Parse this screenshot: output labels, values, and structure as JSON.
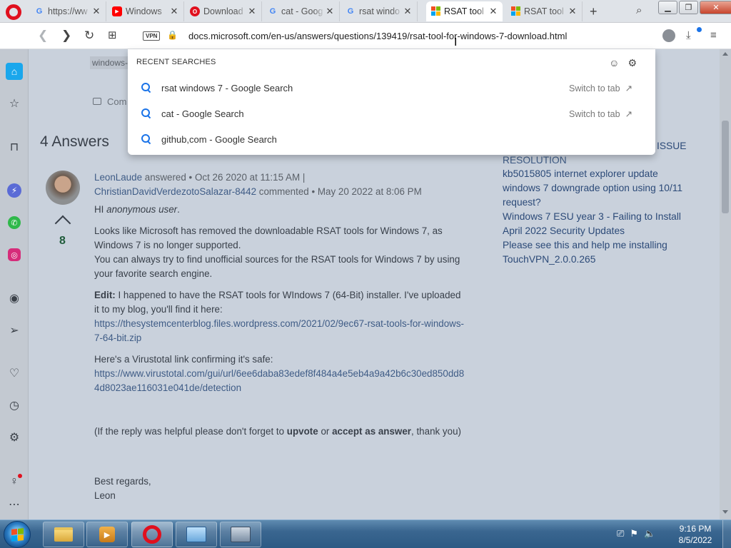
{
  "tabs": [
    {
      "favicon": "google-icon",
      "title": "https://ww"
    },
    {
      "favicon": "youtube-icon",
      "title": "Windows"
    },
    {
      "favicon": "opera-icon",
      "title": "Download"
    },
    {
      "favicon": "google-icon",
      "title": "cat - Goog"
    },
    {
      "favicon": "google-icon",
      "title": "rsat windo"
    },
    {
      "favicon": "microsoft-icon",
      "title": "RSAT tool"
    },
    {
      "favicon": "microsoft-icon",
      "title": "RSAT tool"
    }
  ],
  "toolbar": {
    "vpn_label": "VPN",
    "url": "docs.microsoft.com/en-us/answers/questions/139419/rsat-tool-for-windows-7-download.html"
  },
  "dropdown": {
    "heading": "RECENT SEARCHES",
    "items": [
      {
        "text": "rsat windows 7 - Google Search",
        "action": "Switch to tab"
      },
      {
        "text": "cat - Google Search",
        "action": "Switch to tab"
      },
      {
        "text": "github,com - Google Search",
        "action": ""
      }
    ]
  },
  "page": {
    "tag_fragment": "windows-",
    "comment_label": "Com",
    "answers_heading": "4 Answers",
    "answer": {
      "author": "LeonLaude",
      "answered_meta": "answered • Oct 26 2020 at 11:15 AM |",
      "commenter": "ChristianDavidVerdezotoSalazar-8442",
      "commented_meta": "commented • May 20 2022 at 8:06 PM",
      "greeting": "HI",
      "greeting_user": "anonymous user",
      "p1": "Looks like Microsoft has removed the downloadable RSAT tools for Windows 7, as Windows 7 is no longer supported.",
      "p2": "You can always try to find unofficial sources for the RSAT tools for Windows 7 by using your favorite search engine.",
      "edit_label": "Edit:",
      "edit_text": "I happened to have the RSAT tools for WIndows 7 (64-Bit) installer. I've uploaded it to my blog, you'll find it here:",
      "blog_link": "https://thesystemcenterblog.files.wordpress.com/2021/02/9ec67-rsat-tools-for-windows-7-64-bit.zip",
      "vt_intro": "Here's a Virustotal link confirming it's safe:",
      "vt_link": "https://www.virustotal.com/gui/url/6ee6daba83edef8f484a4e5eb4a9a42b6c30ed850dd84d8023ae116031e041de/detection",
      "footer_pre": "(If the reply was helpful please don't forget to",
      "footer_upvote": "upvote",
      "footer_or": "or",
      "footer_accept": "accept as answer",
      "footer_post": ", thank you)",
      "regards": "Best regards,",
      "signature": "Leon",
      "vote_count": "8"
    },
    "related": {
      "partial_top": "ISSUE",
      "partial_resolution": "RESOLUTION",
      "items": [
        "kb5015805 internet explorer update",
        "windows 7 downgrade option using 10/11 request?",
        "Windows 7 ESU year 3 - Failing to Install April 2022 Security Updates",
        "Please see this and help me installing TouchVPN_2.0.0.265"
      ]
    }
  },
  "taskbar": {
    "time": "9:16 PM",
    "date": "8/5/2022"
  },
  "colors": {
    "opera_red": "#e0101e",
    "link_blue": "#1a73e8",
    "vote_green": "#1e5b3a"
  }
}
